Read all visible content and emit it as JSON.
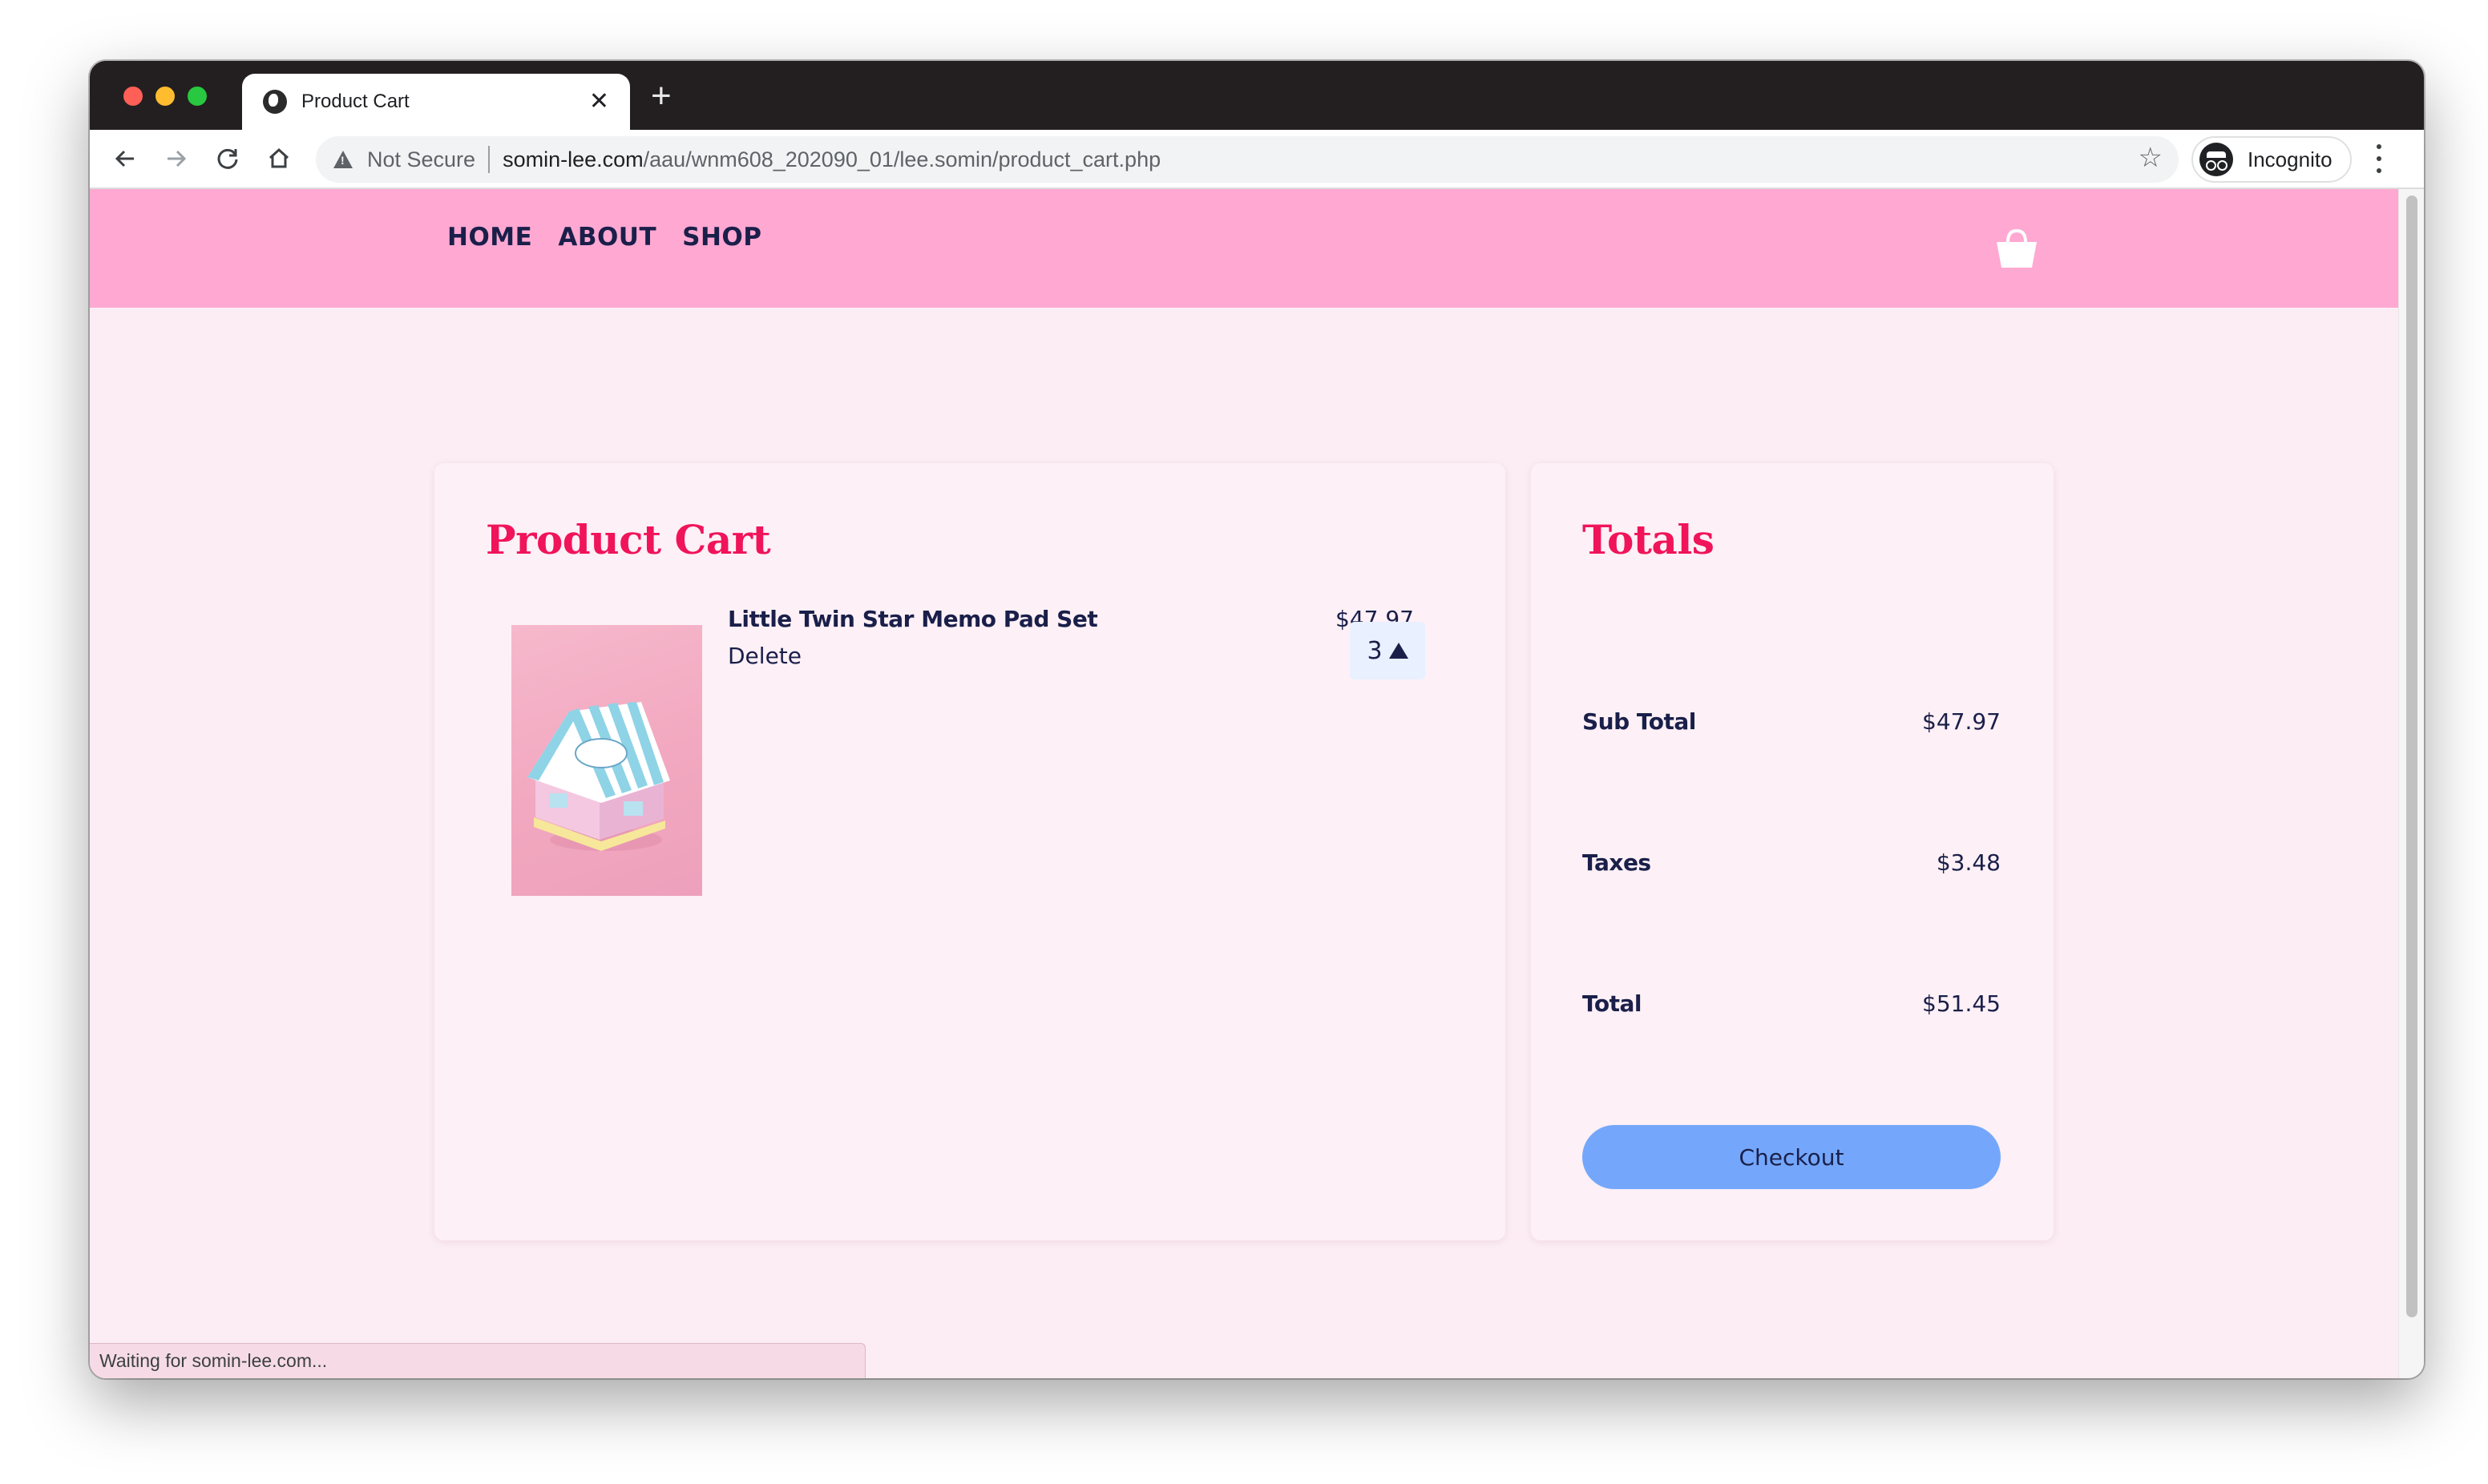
{
  "browser": {
    "tab_title": "Product Cart",
    "new_tab": "+",
    "close": "✕",
    "security_label": "Not Secure",
    "url_host": "somin-lee.com",
    "url_path": "/aau/wnm608_202090_01/lee.somin/product_cart.php",
    "profile_label": "Incognito",
    "status_text": "Waiting for somin-lee.com..."
  },
  "site": {
    "nav": [
      "HOME",
      "ABOUT",
      "SHOP"
    ],
    "header_color": "#ffa8d2",
    "accent_color": "#f0145a",
    "text_color": "#1a1f4a"
  },
  "cart": {
    "title": "Product Cart",
    "items": [
      {
        "name": "Little Twin Star Memo Pad Set",
        "delete_label": "Delete",
        "price": "$47.97",
        "quantity": "3"
      }
    ]
  },
  "totals": {
    "title": "Totals",
    "subtotal_label": "Sub Total",
    "subtotal": "$47.97",
    "taxes_label": "Taxes",
    "taxes": "$3.48",
    "total_label": "Total",
    "total": "$51.45",
    "checkout_label": "Checkout",
    "checkout_color": "#74a7fb"
  }
}
